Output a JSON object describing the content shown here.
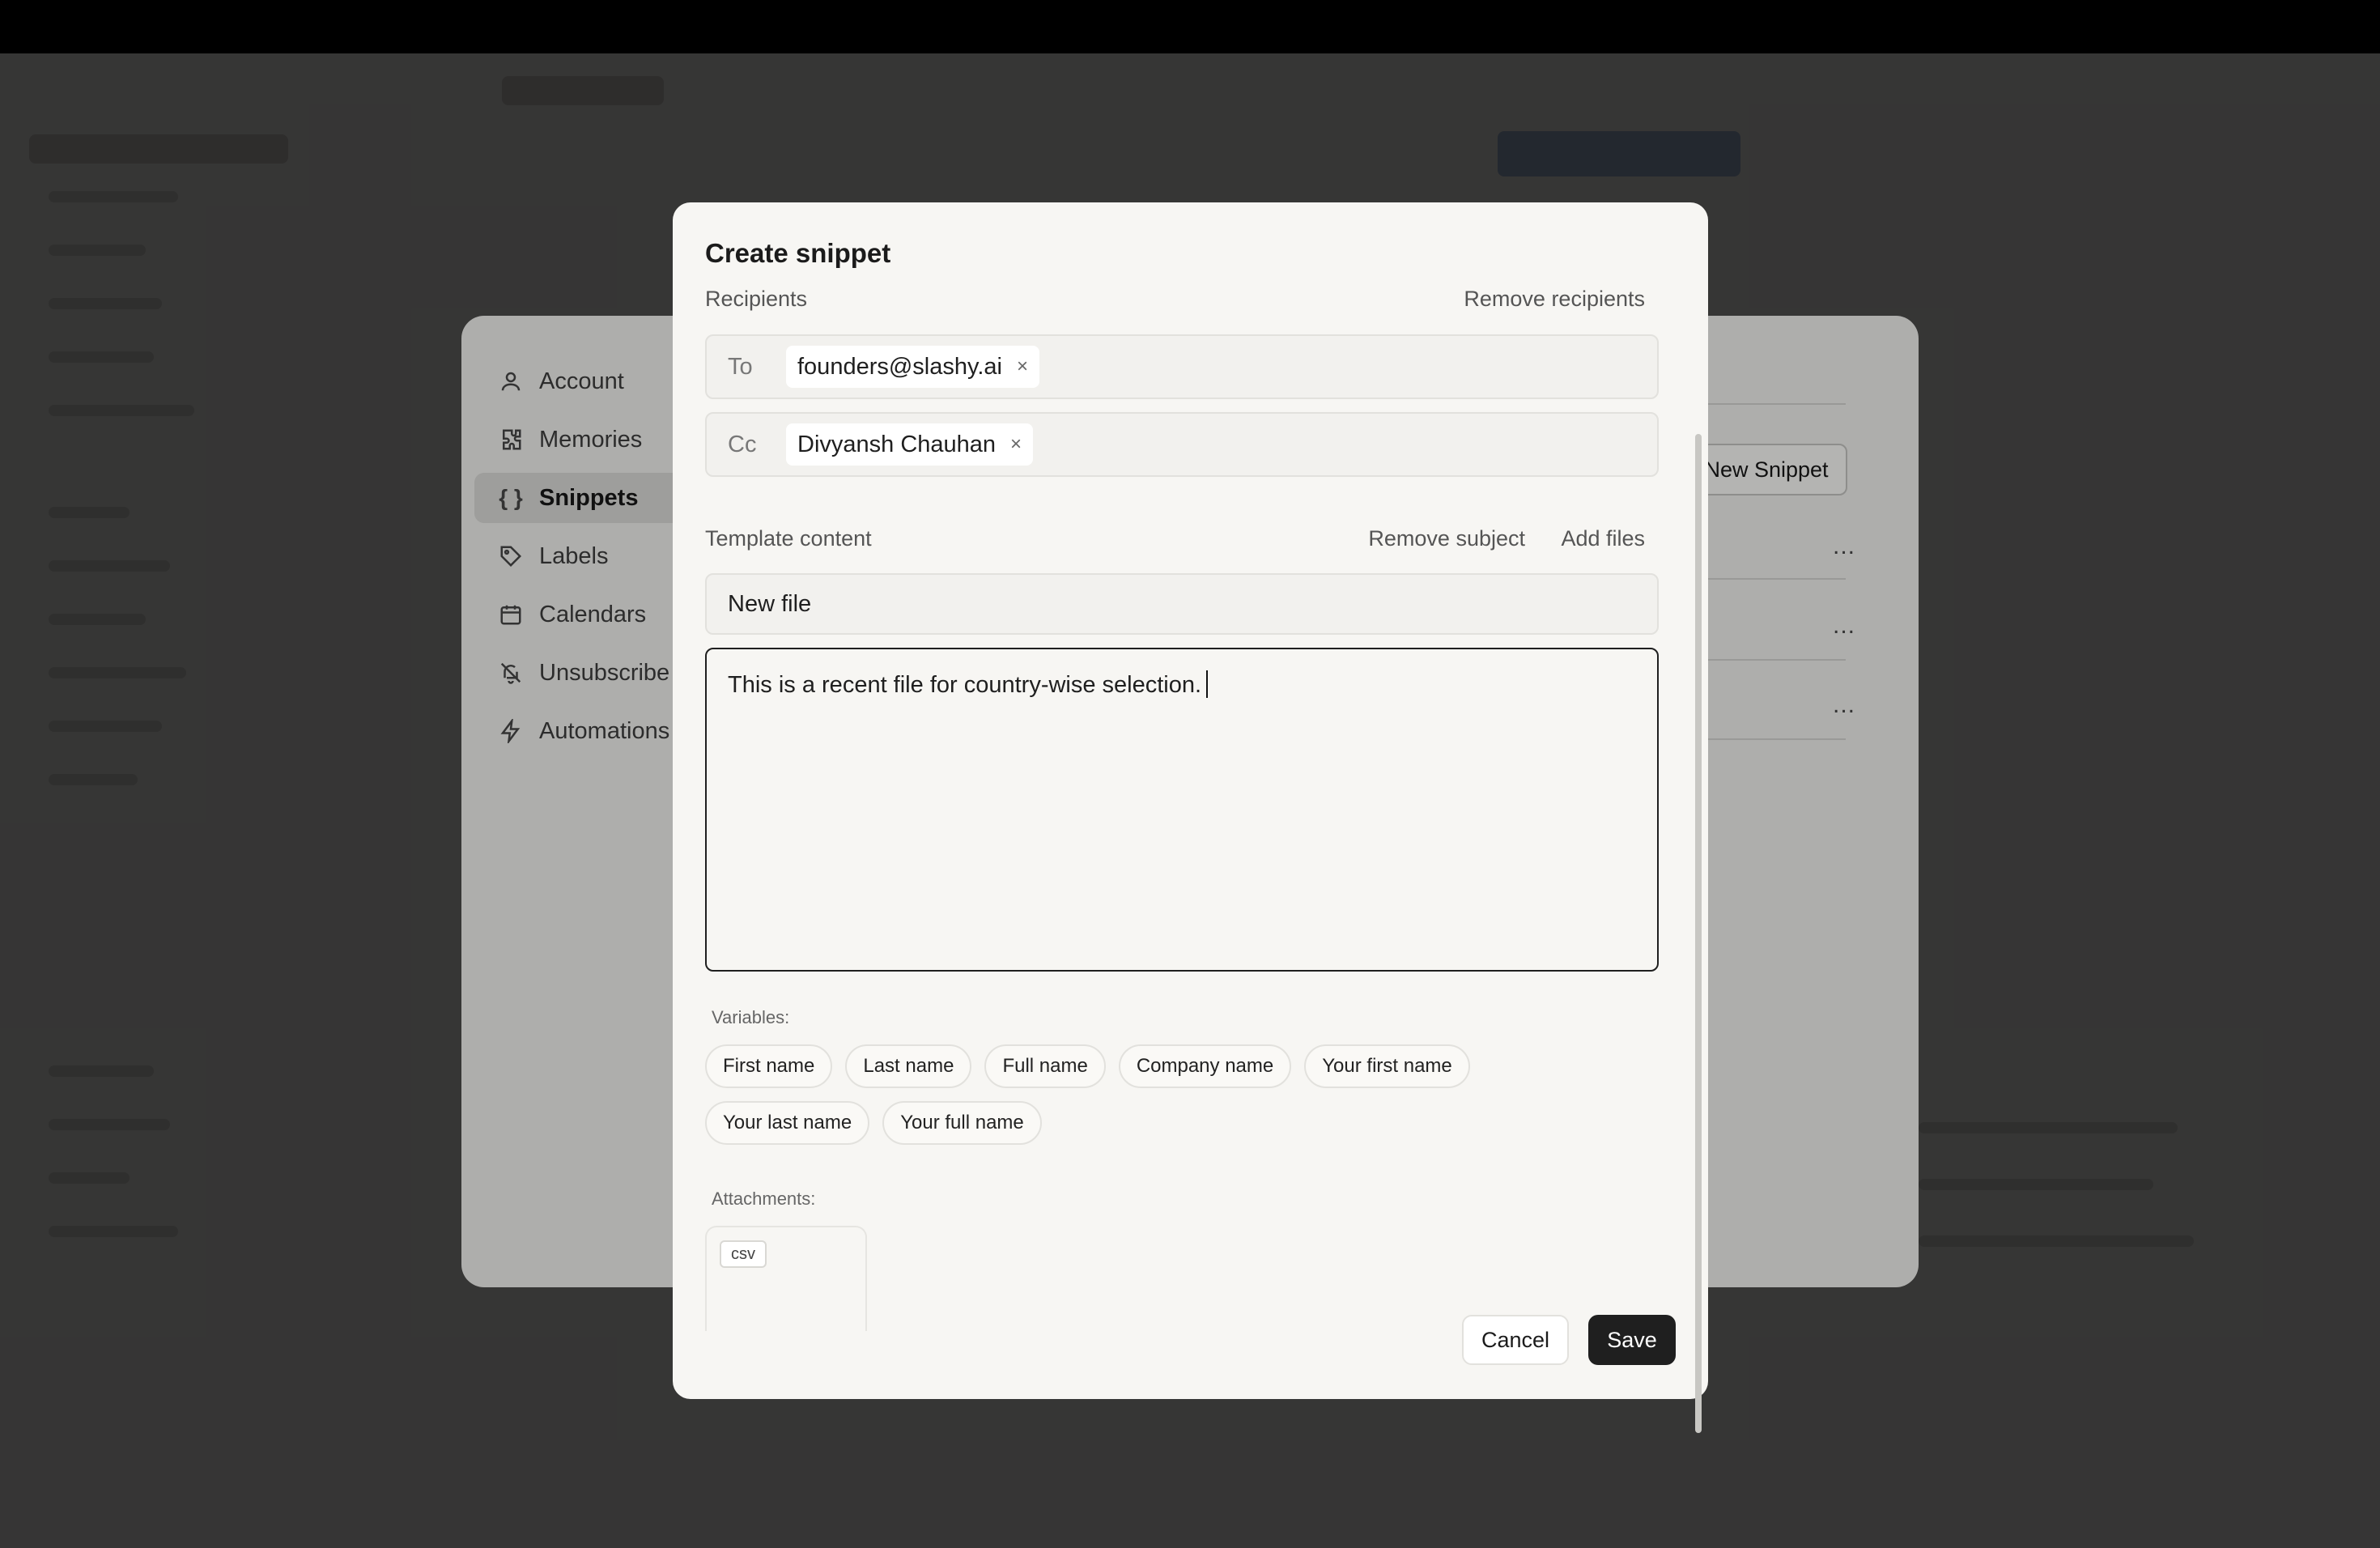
{
  "settings": {
    "nav": [
      {
        "label": "Account",
        "icon": "user-icon"
      },
      {
        "label": "Memories",
        "icon": "puzzle-icon"
      },
      {
        "label": "Snippets",
        "icon": "braces-icon"
      },
      {
        "label": "Labels",
        "icon": "tag-icon"
      },
      {
        "label": "Calendars",
        "icon": "calendar-icon"
      },
      {
        "label": "Unsubscribe",
        "icon": "bell-off-icon"
      },
      {
        "label": "Automations",
        "icon": "bolt-icon"
      }
    ],
    "active": "Snippets",
    "new_snippet_label": "New Snippet",
    "row_menu": "..."
  },
  "dialog": {
    "title": "Create snippet",
    "recipients_label": "Recipients",
    "remove_recipients": "Remove recipients",
    "to_prefix": "To",
    "to_value": "founders@slashy.ai",
    "cc_prefix": "Cc",
    "cc_value": "Divyansh Chauhan",
    "chip_remove": "×",
    "template_label": "Template content",
    "remove_subject": "Remove subject",
    "add_files": "Add files",
    "subject_value": "New file",
    "body_value": "This is a recent file for country-wise selection.",
    "variables_label": "Variables:",
    "variables": [
      "First name",
      "Last name",
      "Full name",
      "Company name",
      "Your first name",
      "Your last name",
      "Your full name"
    ],
    "attachments_label": "Attachments:",
    "attachment_type": "csv",
    "cancel": "Cancel",
    "save": "Save"
  }
}
